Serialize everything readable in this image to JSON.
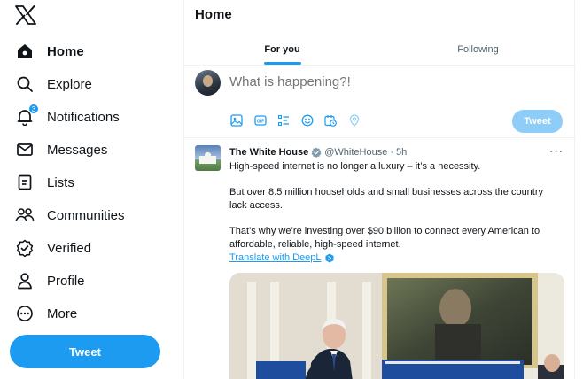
{
  "sidebar": {
    "items": [
      {
        "label": "Home",
        "icon": "home-icon",
        "active": true
      },
      {
        "label": "Explore",
        "icon": "search-icon"
      },
      {
        "label": "Notifications",
        "icon": "bell-icon",
        "badge": "3"
      },
      {
        "label": "Messages",
        "icon": "envelope-icon"
      },
      {
        "label": "Lists",
        "icon": "list-icon"
      },
      {
        "label": "Communities",
        "icon": "people-icon"
      },
      {
        "label": "Verified",
        "icon": "verified-icon"
      },
      {
        "label": "Profile",
        "icon": "person-icon"
      },
      {
        "label": "More",
        "icon": "more-circle-icon"
      }
    ],
    "tweet_button": "Tweet"
  },
  "header": {
    "title": "Home",
    "tabs": [
      {
        "label": "For you",
        "active": true
      },
      {
        "label": "Following",
        "active": false
      }
    ]
  },
  "composer": {
    "placeholder": "What is happening?!",
    "tweet_button": "Tweet",
    "tools": [
      "image-icon",
      "gif-icon",
      "poll-icon",
      "emoji-icon",
      "schedule-icon",
      "location-icon"
    ]
  },
  "tweet": {
    "author": "The White House",
    "handle": "@WhiteHouse",
    "time": "· 5h",
    "more": "···",
    "paragraphs": [
      "High-speed internet is no longer a luxury – it’s a necessity.",
      "But over 8.5 million households and small businesses across the country lack access.",
      "That’s why we’re investing over $90 billion to connect every American to affordable, reliable, high-speed internet."
    ],
    "translate_link": "Translate with DeepL"
  },
  "colors": {
    "accent": "#1d9bf0",
    "accent_disabled": "#8ecdf8",
    "text": "#0f1419",
    "secondary_text": "#536471",
    "border": "#eff3f4"
  }
}
